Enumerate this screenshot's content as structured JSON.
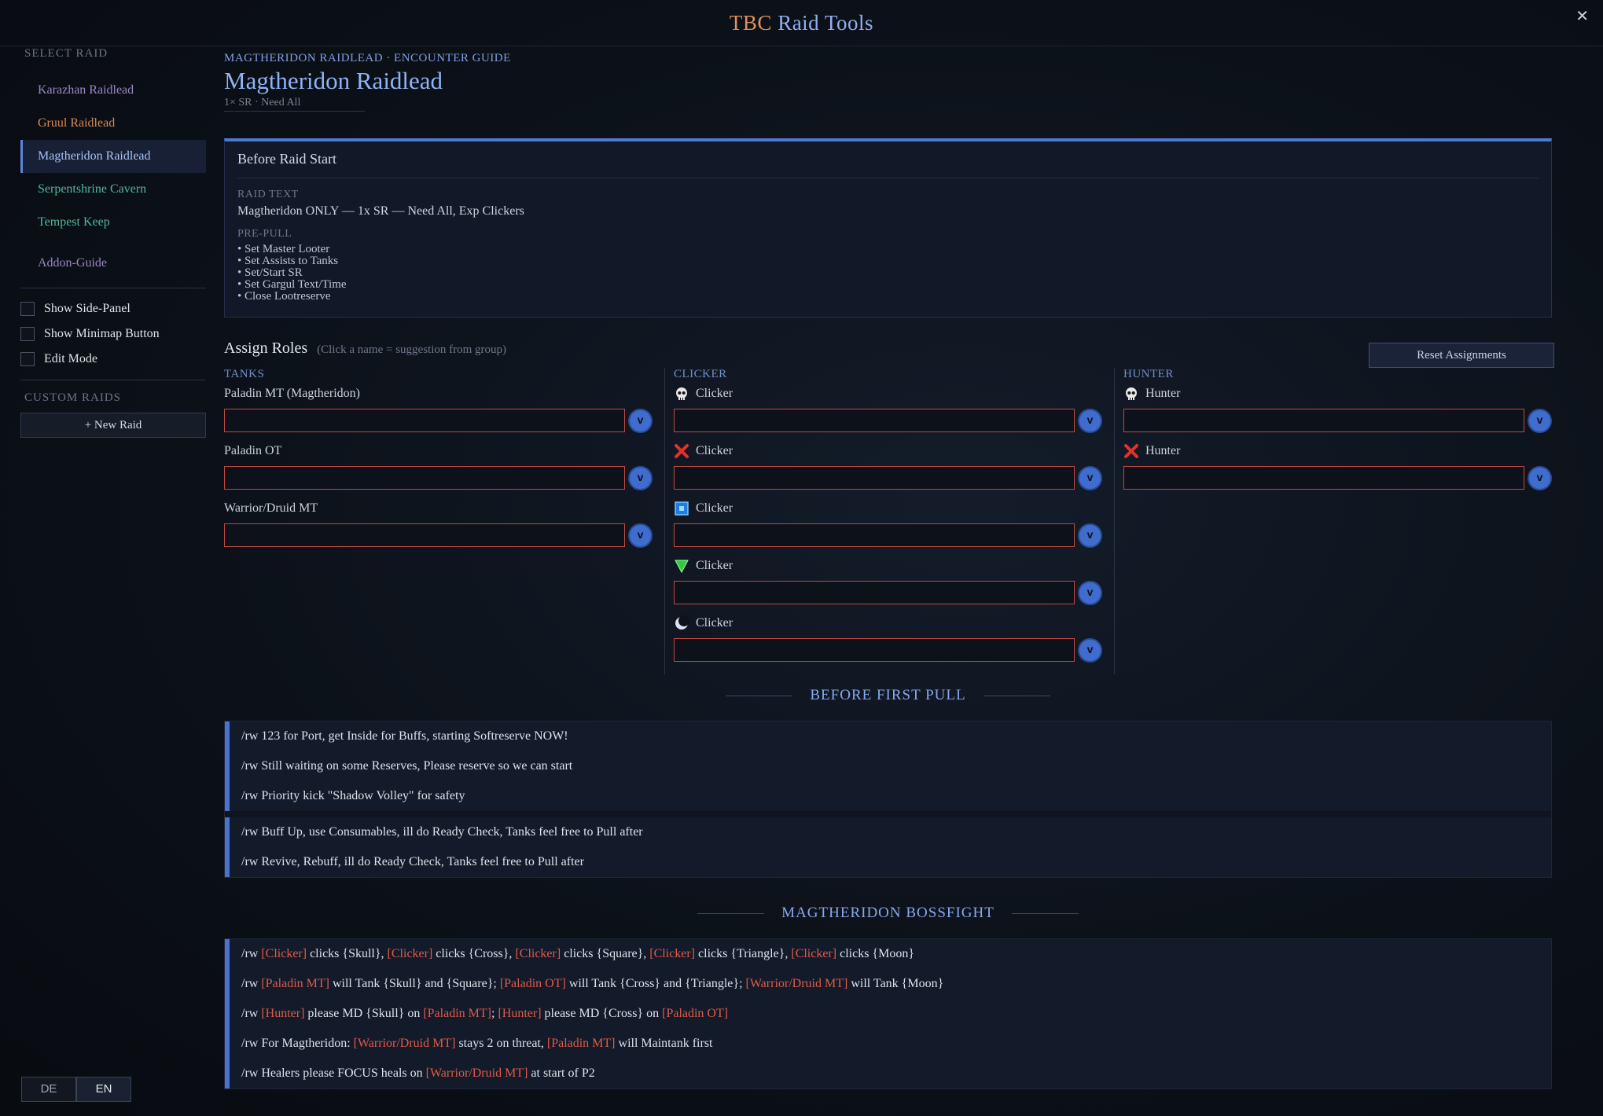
{
  "app": {
    "title_prefix": "TBC",
    "title_suffix": "Raid Tools",
    "close_label": "✕"
  },
  "sidebar": {
    "select_heading": "SELECT RAID",
    "raids": [
      {
        "label": "Karazhan Raidlead",
        "color": "#9b86c9"
      },
      {
        "label": "Gruul Raidlead",
        "color": "#d9894f"
      },
      {
        "label": "Magtheridon Raidlead",
        "color": "#a9c1f5"
      },
      {
        "label": "Serpentshrine Cavern",
        "color": "#4fb89a"
      },
      {
        "label": "Tempest Keep",
        "color": "#4fb89a"
      }
    ],
    "addon_guide": {
      "label": "Addon-Guide",
      "color": "#9b86c9"
    },
    "options": {
      "side_panel": "Show Side-Panel",
      "minimap": "Show Minimap Button",
      "edit_mode": "Edit Mode"
    },
    "custom_heading": "CUSTOM RAIDS",
    "new_raid": "+ New Raid",
    "lang": {
      "de": "DE",
      "en": "EN",
      "active": "EN"
    }
  },
  "main": {
    "breadcrumb": "MAGTHERIDON RAIDLEAD · ENCOUNTER GUIDE",
    "title": "Magtheridon Raidlead",
    "subtitle": "1× SR · Need All",
    "before_raid": {
      "title": "Before Raid Start",
      "raid_text_label": "RAID TEXT",
      "raid_text": "Magtheridon ONLY — 1x SR — Need All, Exp Clickers",
      "prepull_label": "PRE-PULL",
      "prepull": [
        "• Set Master Looter",
        "• Set Assists to Tanks",
        "• Set/Start SR",
        "• Set Gargul Text/Time",
        "• Close Lootreserve"
      ]
    },
    "assign": {
      "title": "Assign Roles",
      "hint": "(Click a name = suggestion from group)",
      "reset": "Reset Assignments",
      "columns": [
        {
          "heading": "TANKS",
          "slots": [
            {
              "label": "Paladin MT (Magtheridon)",
              "icon": "none"
            },
            {
              "label": "Paladin OT",
              "icon": "none"
            },
            {
              "label": "Warrior/Druid MT",
              "icon": "none"
            }
          ]
        },
        {
          "heading": "CLICKER",
          "slots": [
            {
              "label": "Clicker",
              "icon": "skull-icon"
            },
            {
              "label": "Clicker",
              "icon": "cross-icon"
            },
            {
              "label": "Clicker",
              "icon": "square-icon"
            },
            {
              "label": "Clicker",
              "icon": "triangle-icon"
            },
            {
              "label": "Clicker",
              "icon": "moon-icon"
            }
          ]
        },
        {
          "heading": "HUNTER",
          "slots": [
            {
              "label": "Hunter",
              "icon": "skull-icon"
            },
            {
              "label": "Hunter",
              "icon": "cross-icon"
            }
          ]
        }
      ],
      "dropdown_glyph": "v"
    },
    "before_first_pull": {
      "heading": "BEFORE FIRST PULL",
      "group1": [
        "/rw 123 for Port, get Inside for Buffs, starting Softreserve NOW!",
        "/rw Still waiting on some Reserves, Please reserve so we can start",
        "/rw Priority kick \"Shadow Volley\" for safety"
      ],
      "group2": [
        "/rw Buff Up, use Consumables, ill do Ready Check, Tanks feel free to Pull after",
        "/rw Revive, Rebuff, ill do Ready Check, Tanks feel free to Pull after"
      ]
    },
    "bossfight": {
      "heading": "MAGTHERIDON BOSSFIGHT",
      "lines": [
        [
          [
            "/rw ",
            false
          ],
          [
            "[Clicker]",
            true
          ],
          [
            " clicks {Skull}, ",
            false
          ],
          [
            "[Clicker]",
            true
          ],
          [
            " clicks {Cross}, ",
            false
          ],
          [
            "[Clicker]",
            true
          ],
          [
            " clicks {Square}, ",
            false
          ],
          [
            "[Clicker]",
            true
          ],
          [
            " clicks {Triangle}, ",
            false
          ],
          [
            "[Clicker]",
            true
          ],
          [
            " clicks {Moon}",
            false
          ]
        ],
        [
          [
            "/rw ",
            false
          ],
          [
            "[Paladin MT]",
            true
          ],
          [
            " will Tank {Skull} and {Square}; ",
            false
          ],
          [
            "[Paladin OT]",
            true
          ],
          [
            " will Tank {Cross} and {Triangle}; ",
            false
          ],
          [
            "[Warrior/Druid MT]",
            true
          ],
          [
            " will Tank {Moon}",
            false
          ]
        ],
        [
          [
            "/rw ",
            false
          ],
          [
            "[Hunter]",
            true
          ],
          [
            " please MD {Skull} on ",
            false
          ],
          [
            "[Paladin MT]",
            true
          ],
          [
            "; ",
            false
          ],
          [
            "[Hunter]",
            true
          ],
          [
            " please MD {Cross} on ",
            false
          ],
          [
            "[Paladin OT]",
            true
          ]
        ],
        [
          [
            "/rw For Magtheridon: ",
            false
          ],
          [
            "[Warrior/Druid MT]",
            true
          ],
          [
            " stays 2 on threat, ",
            false
          ],
          [
            "[Paladin MT]",
            true
          ],
          [
            " will Maintank first",
            false
          ]
        ],
        [
          [
            "/rw Healers please FOCUS heals on ",
            false
          ],
          [
            "[Warrior/Druid MT]",
            true
          ],
          [
            " at start of P2",
            false
          ]
        ]
      ]
    }
  },
  "colors": {
    "accent": "#5b86e0",
    "highlight": "#e05b47",
    "input_border": "#c14a3f"
  }
}
